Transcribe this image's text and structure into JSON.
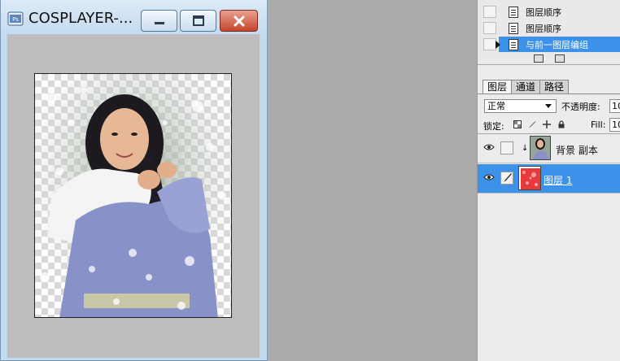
{
  "document": {
    "title": "COSPLAYER-...",
    "app_icon": "photoshop-app-icon",
    "buttons": {
      "minimize": "minimize-icon",
      "maximize": "maximize-icon",
      "close": "close-icon"
    }
  },
  "history": {
    "items": [
      {
        "label": "图层顺序",
        "state": "normal"
      },
      {
        "label": "图层顺序",
        "state": "normal"
      },
      {
        "label": "与前一图层编组",
        "state": "active"
      }
    ]
  },
  "layers": {
    "tabs": [
      {
        "label": "图层",
        "active": true
      },
      {
        "label": "通道",
        "active": false
      },
      {
        "label": "路径",
        "active": false
      }
    ],
    "blend_mode": "正常",
    "opacity_label": "不透明度:",
    "opacity_value": "10",
    "lock_label": "锁定:",
    "fill_label": "Fill:",
    "fill_value": "10",
    "items": [
      {
        "name": "背景 副本",
        "visible": true,
        "selected": false,
        "clipped": true
      },
      {
        "name": "图层 1",
        "visible": true,
        "selected": true,
        "clipped": false
      }
    ]
  },
  "colors": {
    "selection": "#3c91e8",
    "canvas_bg": "#bdbdbd",
    "workspace_bg": "#ababab"
  }
}
